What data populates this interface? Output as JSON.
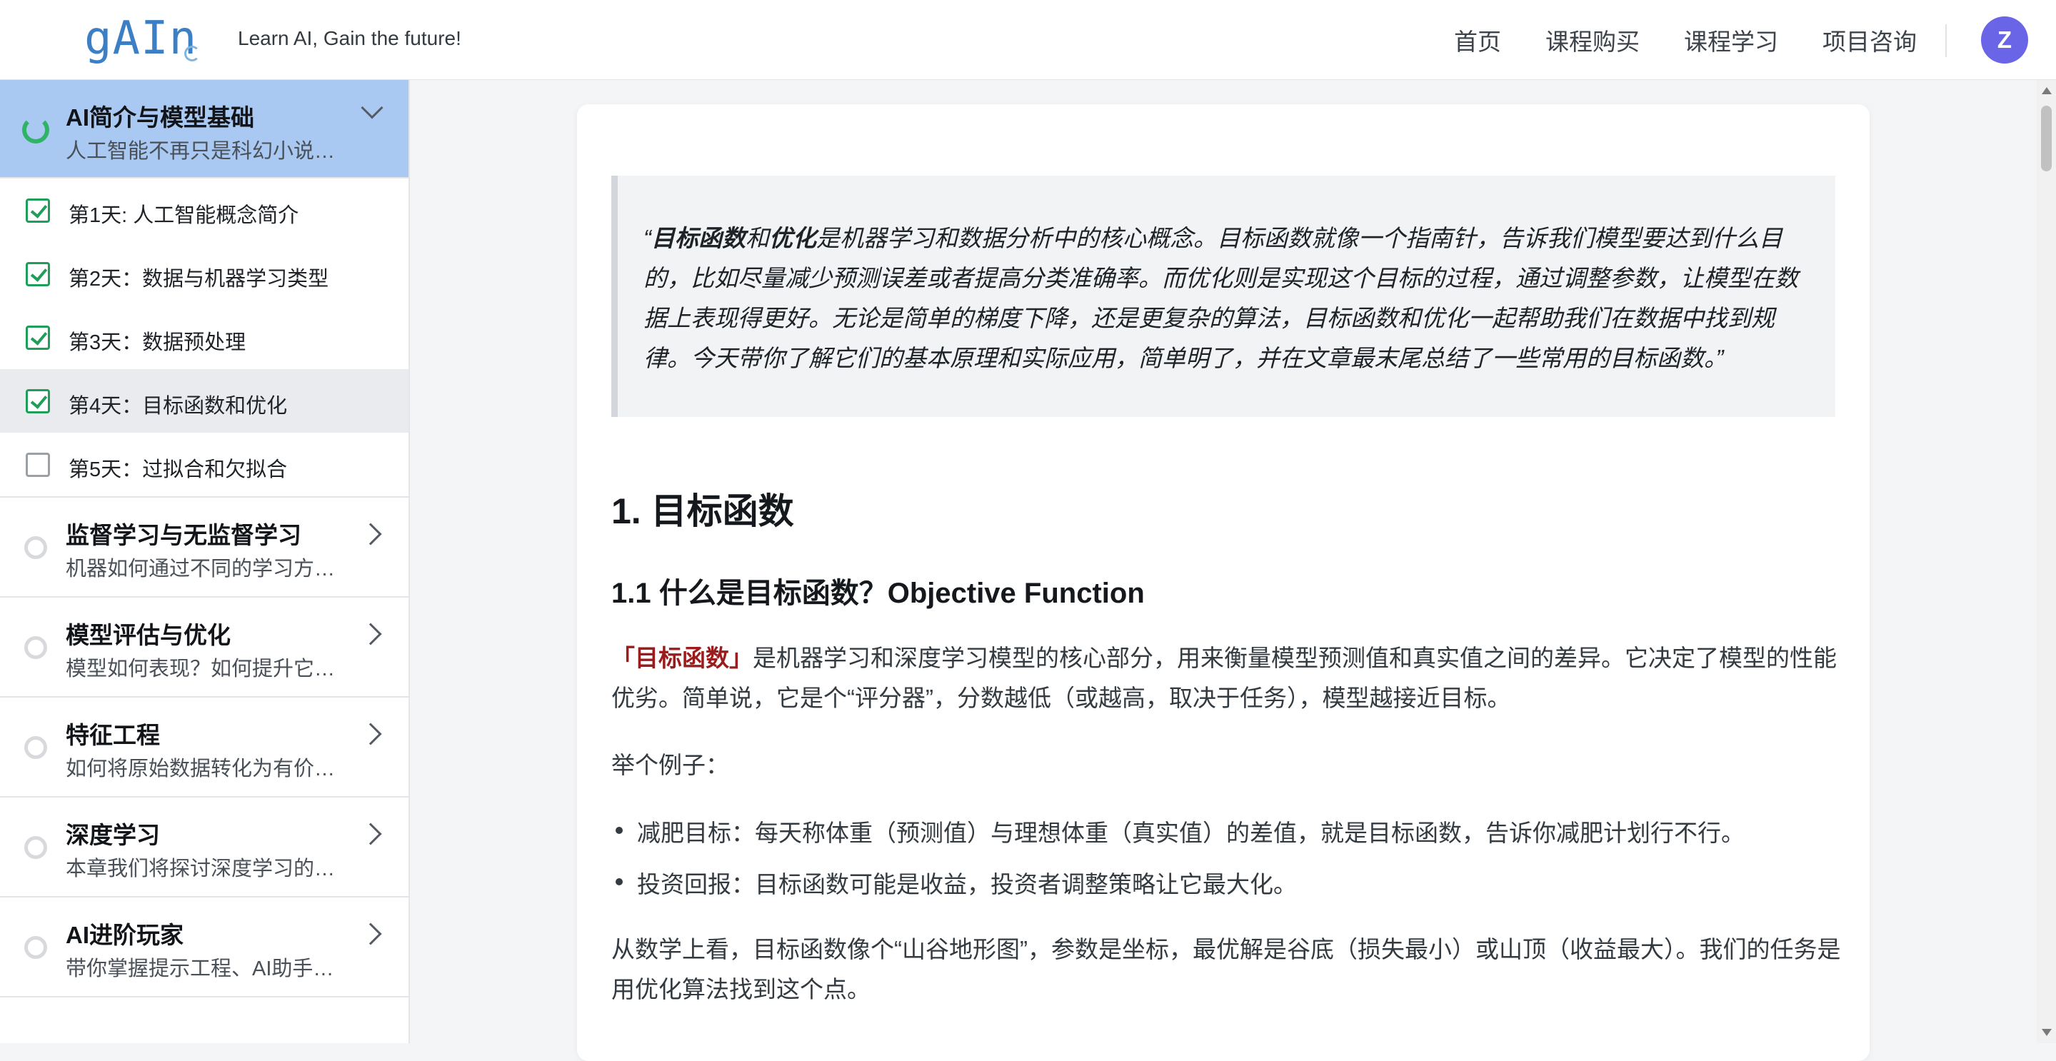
{
  "header": {
    "logo": "gAIn",
    "tagline": "Learn AI, Gain the future!",
    "nav": [
      "首页",
      "课程购买",
      "课程学习",
      "项目咨询"
    ],
    "avatar_letter": "Z"
  },
  "sidebar": {
    "active_chapter": {
      "title": "AI简介与模型基础",
      "desc": "人工智能不再只是科幻小说里…"
    },
    "lessons": [
      {
        "title": "第1天: 人工智能概念简介",
        "done": true
      },
      {
        "title": "第2天：数据与机器学习类型",
        "done": true
      },
      {
        "title": "第3天：数据预处理",
        "done": true
      },
      {
        "title": "第4天：目标函数和优化",
        "done": true,
        "current": true
      },
      {
        "title": "第5天：过拟合和欠拟合",
        "done": false
      }
    ],
    "chapters": [
      {
        "title": "监督学习与无监督学习",
        "desc": "机器如何通过不同的学习方式…"
      },
      {
        "title": "模型评估与优化",
        "desc": "模型如何表现？如何提升它的…"
      },
      {
        "title": "特征工程",
        "desc": "如何将原始数据转化为有价值…"
      },
      {
        "title": "深度学习",
        "desc": "本章我们将探讨深度学习的基…"
      },
      {
        "title": "AI进阶玩家",
        "desc": "带你掌握提示工程、AI助手、…"
      }
    ]
  },
  "article": {
    "quote": {
      "open": "“",
      "term1": "目标函数",
      "and": "和",
      "term2": "优化",
      "rest": "是机器学习和数据分析中的核心概念。目标函数就像一个指南针，告诉我们模型要达到什么目的，比如尽量减少预测误差或者提高分类准确率。而优化则是实现这个目标的过程，通过调整参数，让模型在数据上表现得更好。无论是简单的梯度下降，还是更复杂的算法，目标函数和优化一起帮助我们在数据中找到规律。今天带你了解它们的基本原理和实际应用，简单明了，并在文章最末尾总结了一些常用的目标函数。”"
    },
    "h1": "1. 目标函数",
    "h2": "1.1 什么是目标函数？Objective Function",
    "para1_highlight": "「目标函数」",
    "para1_rest": "是机器学习和深度学习模型的核心部分，用来衡量模型预测值和真实值之间的差异。它决定了模型的性能优劣。简单说，它是个“评分器”，分数越低（或越高，取决于任务），模型越接近目标。",
    "para2": "举个例子：",
    "bullets": [
      "减肥目标：每天称体重（预测值）与理想体重（真实值）的差值，就是目标函数，告诉你减肥计划行不行。",
      "投资回报：目标函数可能是收益，投资者调整策略让它最大化。"
    ],
    "para3": "从数学上看，目标函数像个“山谷地形图”，参数是坐标，最优解是谷底（损失最小）或山顶（收益最大）。我们的任务是用优化算法找到这个点。"
  },
  "colors": {
    "active_chapter_bg": "#a9c9f2",
    "check_green": "#1e9e58",
    "progress_green": "#2fb365",
    "highlight_red": "#9b1c1c",
    "avatar_bg": "#6a65e6"
  }
}
